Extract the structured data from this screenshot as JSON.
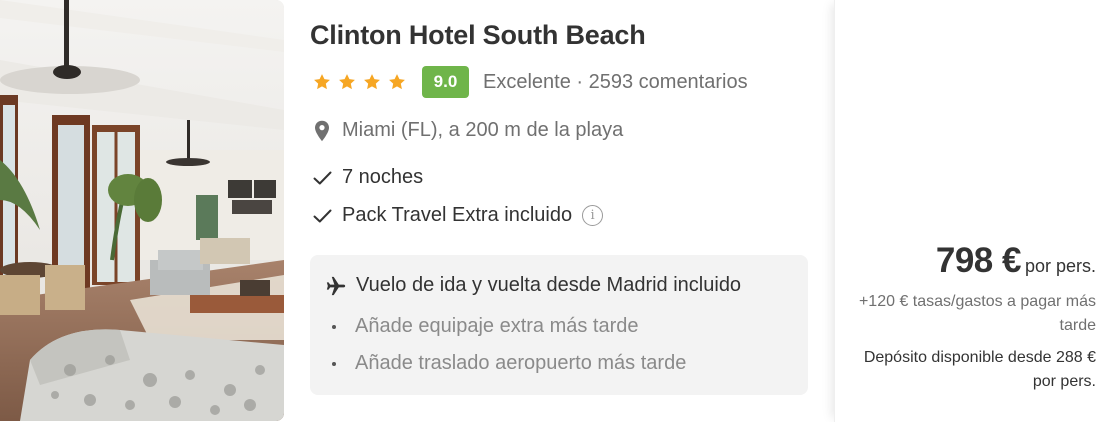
{
  "hotel": {
    "name": "Clinton Hotel South Beach",
    "stars": 4,
    "score": "9.0",
    "rating_text": "Excelente · 2593 comentarios",
    "location": "Miami (FL), a 200 m de la playa"
  },
  "features": [
    {
      "text": "7 noches"
    },
    {
      "text": "Pack Travel Extra incluido"
    }
  ],
  "flight": {
    "title": "Vuelo de ida y vuelta desde Madrid incluido",
    "options": [
      "Añade equipaje extra más tarde",
      "Añade traslado aeropuerto más tarde"
    ]
  },
  "price": {
    "amount": "798 €",
    "per": "por pers.",
    "taxes": "+120 € tasas/gastos a pagar más tarde",
    "deposit": "Depósito disponible desde 288 € por pers."
  },
  "icons": {
    "star": "star-icon",
    "location": "map-pin-icon",
    "check": "check-icon",
    "info": "info-icon",
    "plane": "plane-icon"
  },
  "colors": {
    "star": "#f6a623",
    "score_badge": "#6fb54a",
    "flight_box": "#f3f3f3",
    "muted_text": "#707070"
  }
}
